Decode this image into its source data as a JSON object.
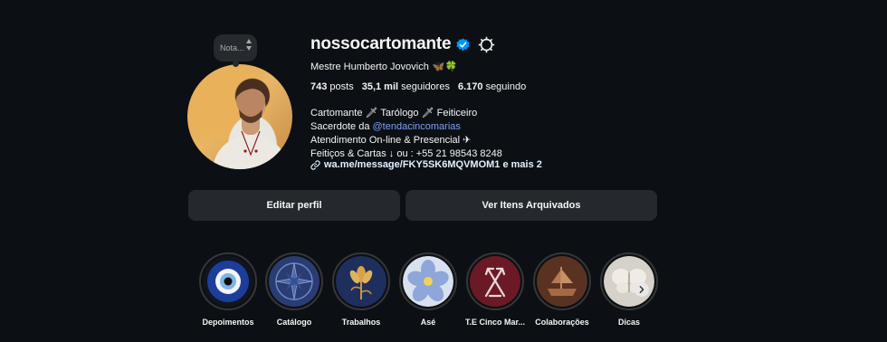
{
  "note": {
    "placeholder": "Nota..."
  },
  "profile": {
    "username": "nossocartomante",
    "full_name": "Mestre Humberto Jovovich",
    "full_name_emojis": "🦋🍀",
    "stats": {
      "posts_value": "743",
      "posts_label": "posts",
      "followers_value": "35,1 mil",
      "followers_label": "seguidores",
      "following_value": "6.170",
      "following_label": "seguindo"
    },
    "bio": {
      "line1": "Cartomante 🗡 Tarólogo 🗡 Feiticeiro",
      "line2_prefix": "Sacerdote da ",
      "line2_mention": "@tendacincomarias",
      "line3": "Atendimento On-line & Presencial ✈",
      "line4": "Feitiços & Cartas ↓ ou : +55 21 98543 8248"
    },
    "link": "wa.me/message/FKY5SK6MQVMOM1 e mais 2"
  },
  "buttons": {
    "edit_profile": "Editar perfil",
    "view_archive": "Ver Itens Arquivados"
  },
  "highlights": [
    {
      "label": "Depoimentos",
      "icon": "evil-eye"
    },
    {
      "label": "Catálogo",
      "icon": "compass-rose"
    },
    {
      "label": "Trabalhos",
      "icon": "flower"
    },
    {
      "label": "Asé",
      "icon": "frangipani"
    },
    {
      "label": "T.E Cinco Mar...",
      "icon": "trident"
    },
    {
      "label": "Colaborações",
      "icon": "ship"
    },
    {
      "label": "Dicas",
      "icon": "butterfly"
    }
  ],
  "colors": {
    "background": "#0c1014",
    "button": "#25292e",
    "mention": "#7c9ffd",
    "verified": "#0095f6"
  }
}
